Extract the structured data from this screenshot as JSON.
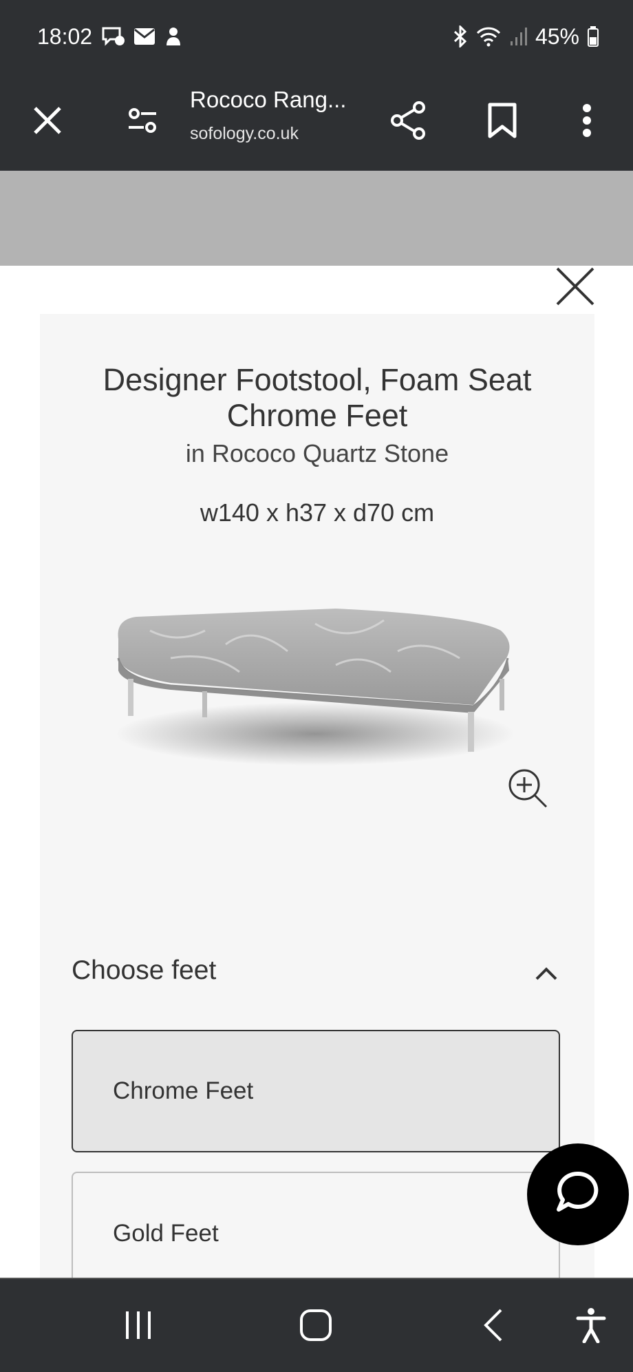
{
  "status_bar": {
    "time": "18:02",
    "battery": "45%",
    "icons": [
      "messenger-icon",
      "mail-icon",
      "notification-icon",
      "bluetooth-icon",
      "wifi-icon",
      "signal-icon",
      "battery-icon"
    ]
  },
  "browser": {
    "title": "Rococo Rang...",
    "url": "sofology.co.uk",
    "icons": [
      "close-icon",
      "page-settings-icon",
      "share-icon",
      "bookmark-icon",
      "more-vertical-icon"
    ]
  },
  "product": {
    "title_line1": "Designer Footstool, Foam Seat",
    "title_line2": "Chrome Feet",
    "subtitle": "in Rococo Quartz Stone",
    "dimensions": "w140 x h37 x d70 cm"
  },
  "feet_section": {
    "title": "Choose feet",
    "options": [
      {
        "label": "Chrome Feet",
        "selected": true
      },
      {
        "label": "Gold Feet",
        "selected": false
      }
    ]
  },
  "colors": {
    "chrome_dark": "#2e3033",
    "card_bg": "#f6f6f6",
    "selected_bg": "#e5e5e5",
    "text": "#333333"
  }
}
